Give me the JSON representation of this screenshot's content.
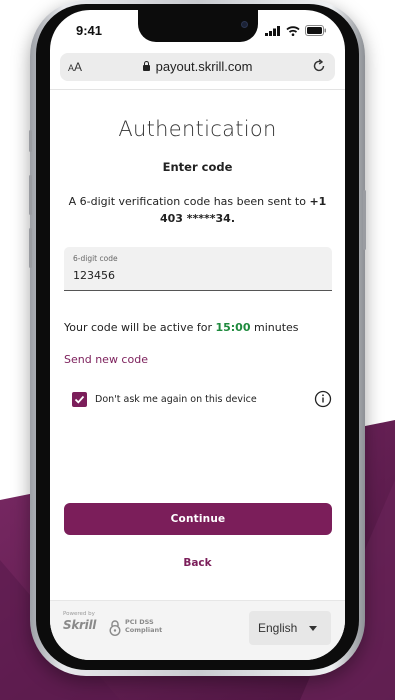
{
  "status_bar": {
    "time": "9:41"
  },
  "browser": {
    "text_size_label_small": "A",
    "text_size_label": "A",
    "url": "payout.skrill.com"
  },
  "page": {
    "title": "Authentication",
    "subtitle": "Enter code",
    "info_prefix": "A 6-digit verification code has been sent to ",
    "phone_number": "+1 403 *****34.",
    "code_field": {
      "label": "6-digit code",
      "value": "123456"
    },
    "active_prefix": "Your code will be active for ",
    "timer": "15:00",
    "active_suffix": " minutes",
    "send_new_code": "Send new code",
    "remember_device": {
      "label": "Don't ask me again on this device",
      "checked": true
    },
    "continue_label": "Continue",
    "back_label": "Back"
  },
  "footer": {
    "powered_by": "Powered by",
    "brand": "Skrill",
    "pci_line1": "PCI DSS",
    "pci_line2": "Compliant",
    "language": "English"
  },
  "colors": {
    "accent": "#7b1e5a",
    "timer": "#1e8a3d",
    "background_purple": "#5d1b4c"
  },
  "icons": [
    "signal-icon",
    "wifi-icon",
    "battery-icon",
    "lock-icon",
    "reload-icon",
    "checkmark-icon",
    "info-icon",
    "shield-lock-icon",
    "caret-down-icon"
  ]
}
